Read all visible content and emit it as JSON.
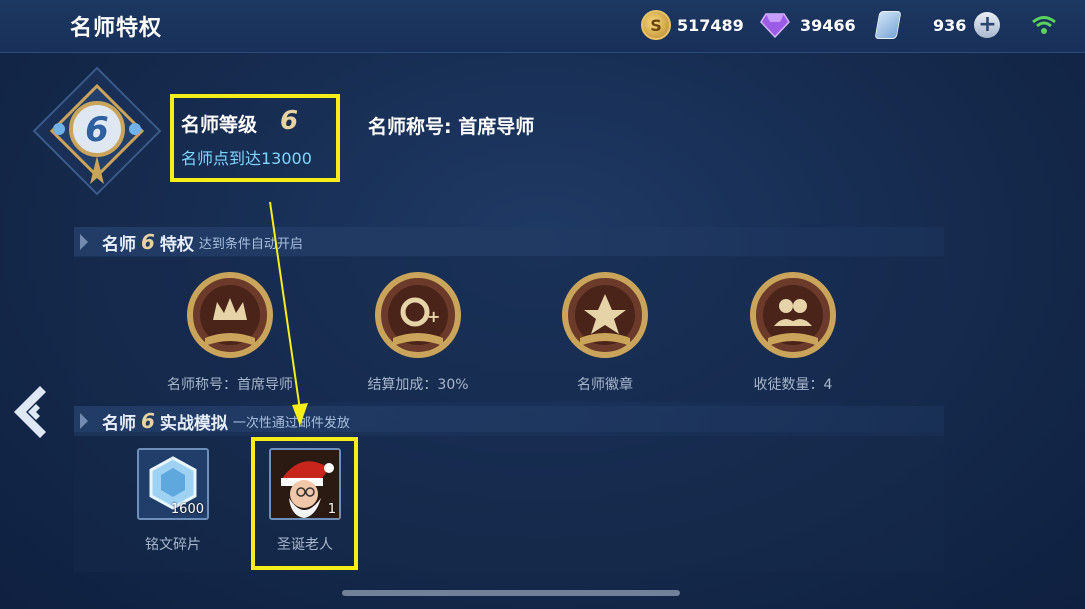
{
  "header": {
    "title": "名师特权",
    "gold": "517489",
    "diamonds": "39466",
    "tickets": "936"
  },
  "level": {
    "label": "名师等级",
    "number": "6",
    "sub": "名师点到达13000",
    "title_text": "名师称号: 首席导师"
  },
  "privileges": {
    "section_name_a": "名师",
    "section_num": "6",
    "section_name_b": "特权",
    "section_sub": "达到条件自动开启",
    "items": [
      {
        "label": "名师称号：首席导师",
        "icon": "crown-book-icon"
      },
      {
        "label": "结算加成：30%",
        "icon": "bonus-book-icon"
      },
      {
        "label": "名师徽章",
        "icon": "badge-book-icon"
      },
      {
        "label": "收徒数量：4",
        "icon": "people-book-icon"
      }
    ]
  },
  "rewards": {
    "section_name_a": "名师",
    "section_num": "6",
    "section_name_b": "实战模拟",
    "section_sub": "一次性通过邮件发放",
    "items": [
      {
        "label": "铭文碎片",
        "count": "1600"
      },
      {
        "label": "圣诞老人",
        "count": "1"
      }
    ]
  },
  "colors": {
    "highlight": "#f5ee19",
    "accent_gold": "#e8d3a0",
    "sub_text": "#7fd6ff"
  }
}
